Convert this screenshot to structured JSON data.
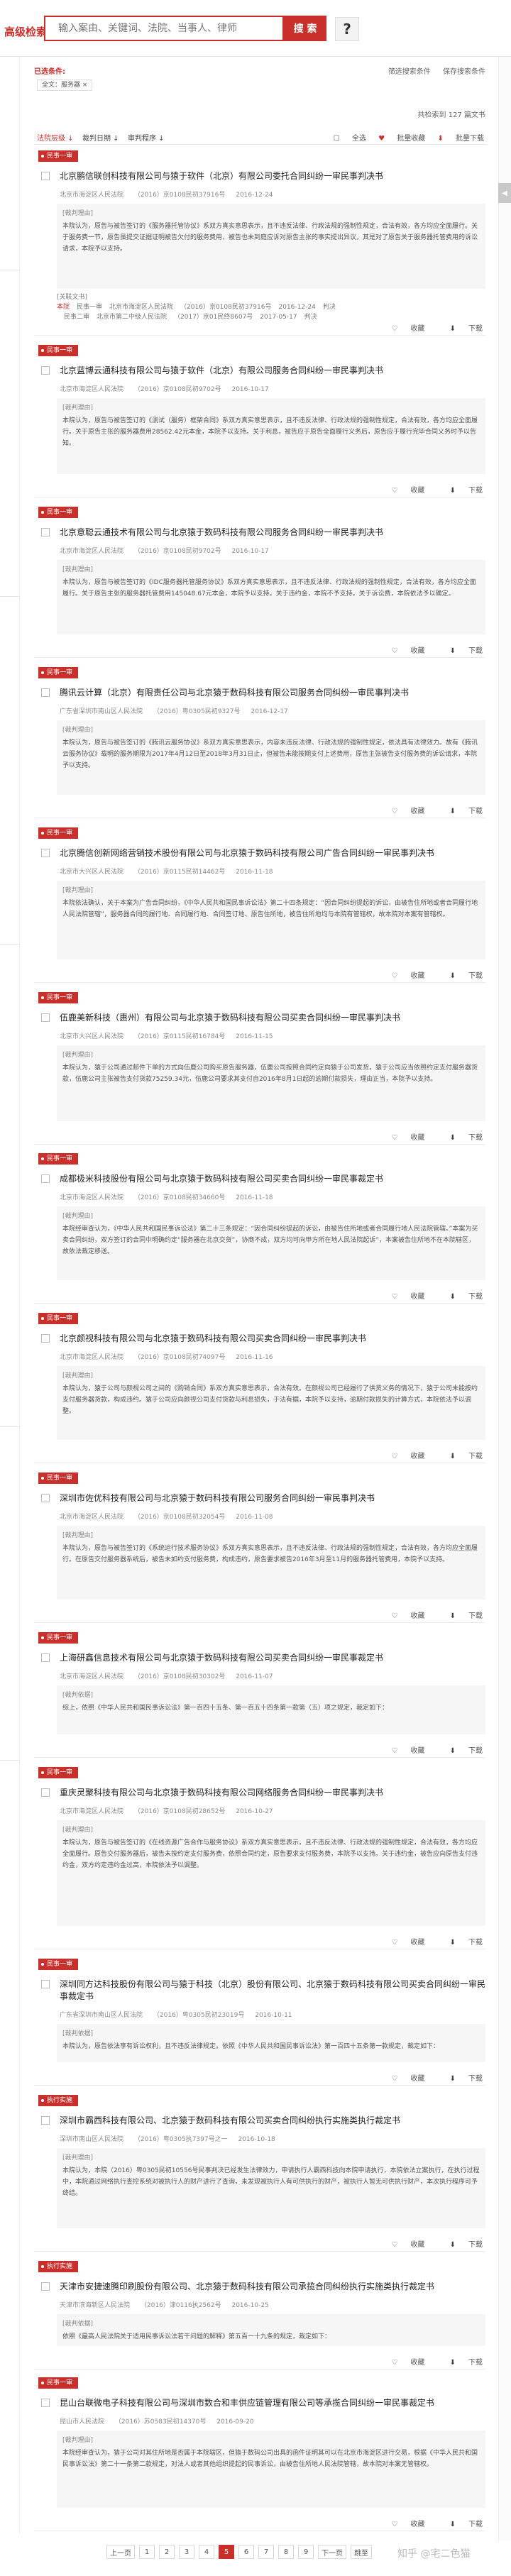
{
  "header": {
    "search_label": "高级检索",
    "search_placeholder": "输入案由、关键词、法院、当事人、律师",
    "search_button": "搜 索",
    "help_button": "?"
  },
  "filter": {
    "title": "已选条件:",
    "tag": "全文：服务器 ×",
    "links": [
      "筛选搜索条件",
      "保存搜索条件"
    ]
  },
  "result_count": "共检索到 127 篇文书",
  "sortbar": {
    "items": [
      "法院层级 ↓",
      "裁判日期 ↓",
      "审判程序 ↓"
    ],
    "tools": [
      "全选",
      "批量收藏",
      "批量下载"
    ]
  },
  "actions": {
    "favorite": "收藏",
    "download": "下载"
  },
  "cases": [
    {
      "tag": "民事一审",
      "title": "北京鹏信联创科技有限公司与猿于软件（北京）有限公司委托合同纠纷一审民事判决书",
      "court": "北京市海淀区人民法院",
      "case_no": "（2016）京0108民初37916号",
      "date": "2016-12-24",
      "label": "[裁判理由]",
      "excerpt": "本院认为，原告与被告签订的《服务器托管协议》系双方真实意思表示，且不违反法律、行政法规的强制性规定，合法有效，各方均应全面履行。关于服务费一节，原告虽提交证据证明被告欠付的服务费用，被告也未到庭应诉对原告主张的事实提出异议，其是对了原告关于服务器托管费用的诉讼请求，本院予以支持。",
      "trial_title": "[关联文书]",
      "trial_rows": [
        [
          "本院",
          "民事一审",
          "北京市海淀区人民法院",
          "（2016）京0108民初37916号",
          "2016-12-24",
          "判决"
        ],
        [
          "",
          "民事二审",
          "北京市第二中级人民法院",
          "（2017）京01民终8607号",
          "2017-05-17",
          "判决"
        ]
      ]
    },
    {
      "tag": "民事一审",
      "title": "北京蓝博云通科技有限公司与猿于软件（北京）有限公司服务合同纠纷一审民事判决书",
      "court": "北京市海淀区人民法院",
      "case_no": "（2016）京0108民初9702号",
      "date": "2016-10-17",
      "label": "[裁判理由]",
      "excerpt": "本院认为，原告与被告签订的《测试（服务）框架合同》系双方真实意思表示，且不违反法律、行政法规的强制性规定，合法有效，各方均应全面履行。关于原告主张的服务器费用28562.42元本金，本院予以支持。关于利息，被告应于原告全面履行义务后，原告应于履行完毕合同义务时予以告知。"
    },
    {
      "tag": "民事一审",
      "title": "北京意聪云通技术有限公司与北京猿于数码科技有限公司服务合同纠纷一审民事判决书",
      "court": "北京市海淀区人民法院",
      "case_no": "（2016）京0108民初9702号",
      "date": "2016-10-17",
      "label": "[裁判理由]",
      "excerpt": "本院认为，原告与被告签订的《IDC服务器托管服务协议》系双方真实意思表示，且不违反法律、行政法规的强制性规定，合法有效，各方均应全面履行。关于原告主张的服务器托管费用145048.67元本金，本院予以支持。关于违约金，本院不予支持。关于诉讼费，本院依法予以确定。"
    },
    {
      "tag": "民事一审",
      "title": "腾讯云计算（北京）有限责任公司与北京猿于数码科技有限公司服务合同纠纷一审民事判决书",
      "court": "广东省深圳市南山区人民法院",
      "case_no": "（2016）粤0305民初9327号",
      "date": "2016-12-17",
      "label": "[裁判理由]",
      "excerpt": "本院认为，原告与被告签订的《腾讯云服务协议》系双方真实意思表示，内容未违反法律、行政法规的强制性规定，依法具有法律效力。故有《腾讯云服务协议》载明的服务期限为2017年4月12日至2018年3月31日止，但被告未能按期支付上述费用，原告主张被告支付服务费的诉讼请求，本院予以支持。"
    },
    {
      "tag": "民事一审",
      "title": "北京腾信创新网络营销技术股份有限公司与北京猿于数码科技有限公司广告合同纠纷一审民事判决书",
      "court": "北京市大兴区人民法院",
      "case_no": "（2016）京0115民初14462号",
      "date": "2016-11-18",
      "label": "[裁判理由]",
      "excerpt": "本院依法确认，关于本案为广告合同纠纷，《中华人民共和国民事诉讼法》第二十四条规定：“因合同纠纷提起的诉讼，由被告住所地或者合同履行地人民法院管辖”，服务器合同的履行地、合同履行地、合同签订地、原告住所地，被告住所地均与本院有管辖权，故本院对本案有管辖权。"
    },
    {
      "tag": "民事一审",
      "title": "伍鹿美新科技（惠州）有限公司与北京猿于数码科技有限公司买卖合同纠纷一审民事判决书",
      "court": "北京市大兴区人民法院",
      "case_no": "（2016）京0115民初16784号",
      "date": "2016-11-15",
      "label": "[裁判理由]",
      "excerpt": "本院认为，猿于公司通过邮件下单的方式向伍鹿公司购买原告服务器，伍鹿公司按照合同约定向猿于公司发货，猿于公司应当依照约定支付服务器货款，伍鹿公司主张被告支付货款75259.34元，伍鹿公司要求其支付自2016年8月1日起的逾期付款损失，理由正当，本院予以支持。"
    },
    {
      "tag": "民事一审",
      "title": "成都极米科技股份有限公司与北京猿于数码科技有限公司买卖合同纠纷一审民事裁定书",
      "court": "北京市海淀区人民法院",
      "case_no": "（2016）京0108民初34660号",
      "date": "2016-11-18",
      "label": "[裁判理由]",
      "excerpt": "本院经审查认为，《中华人民共和国民事诉讼法》第二十三条规定：“因合同纠纷提起的诉讼，由被告住所地或者合同履行地人民法院管辖。”本案为买卖合同纠纷，双方签订的合同中明确约定“服务器在北京交货”，协商不成，双方均可向甲方所在地人民法院起诉”，本案被告住所地不在本院辖区，故依法裁定移送。"
    },
    {
      "tag": "民事一审",
      "title": "北京颜视科技有限公司与北京猿于数码科技有限公司买卖合同纠纷一审民事判决书",
      "court": "北京市海淀区人民法院",
      "case_no": "（2016）京0108民初74097号",
      "date": "2016-11-16",
      "label": "[裁判理由]",
      "excerpt": "本院认为，猿于公司与颜视公司之间的《购销合同》系双方真实意思表示，合法有效。在颜视公司已经履行了供货义务的情况下，猿于公司未能按约支付服务器货款，构成违约。猿于公司应向颜视公司支付货款与利息损失，于法有据，本院予以支持，逾期付款损失的计算方式，本院依法予以调整。"
    },
    {
      "tag": "民事一审",
      "title": "深圳市佐优科技有限公司与北京猿于数码科技有限公司服务合同纠纷一审民事判决书",
      "court": "北京市海淀区人民法院",
      "case_no": "（2016）京0108民初32054号",
      "date": "2016-11-08",
      "label": "[裁判理由]",
      "excerpt": "本院认为，原告与被告签订的《系统运行技术服务协议》系双方真实意思表示，且不违反法律、行政法规的强制性规定，合法有效，各方均应全面履行。在原告交付服务器系统后，被告未如约支付服务费，构成违约，原告要求被告2016年3月至11月的服务器托管费用，本院予以支持。"
    },
    {
      "tag": "民事一审",
      "title": "上海研鑫信息技术有限公司与北京猿于数码科技有限公司买卖合同纠纷一审民事裁定书",
      "court": "北京市海淀区人民法院",
      "case_no": "（2016）京0108民初30302号",
      "date": "2016-11-07",
      "label": "[裁判依据]",
      "excerpt": "综上，依照《中华人民共和国民事诉讼法》第一百四十五条、第一百五十四条第一款第（五）项之规定，裁定如下："
    },
    {
      "tag": "民事一审",
      "title": "重庆灵聚科技有限公司与北京猿于数码科技有限公司网络服务合同纠纷一审民事判决书",
      "court": "北京市海淀区人民法院",
      "case_no": "（2016）京0108民初28652号",
      "date": "2016-10-27",
      "label": "[裁判理由]",
      "excerpt": "本院认为，原告与被告签订的《在线资源广告合作与服务协议》系双方真实意思表示，且不违反法律、行政法规的强制性规定，合法有效，各方均应全面履行。原告交付服务器后，被告未按约定支付服务费，依照合同约定，原告要求支付服务费，本院予以支持。关于违约金，被告应向原告支付违约金，双方约定违约金过高，本院依法予以调整。"
    },
    {
      "tag": "民事一审",
      "title": "深圳同方达科技股份有限公司与猿于科技（北京）股份有限公司、北京猿于数码科技有限公司买卖合同纠纷一审民事裁定书",
      "court": "广东省深圳市南山区人民法院",
      "case_no": "（2016）粤0305民初23019号",
      "date": "2016-10-11",
      "label": "[裁判依据]",
      "excerpt": "本院认为，原告依法享有诉讼权利，且不违反法律规定。依照《中华人民共和国民事诉讼法》第一百四十五条第一款规定，裁定如下："
    },
    {
      "tag": "执行实施",
      "title": "深圳市霸西科技有限公司、北京猿于数码科技有限公司买卖合同纠纷执行实施类执行裁定书",
      "court": "深圳市南山区人民法院",
      "case_no": "（2016）粤0305执7397号之一",
      "date": "2016-10-18",
      "label": "[裁判理由]",
      "excerpt": "本院认为，本院（2016）粤0305民初10556号民事判决已经发生法律效力，申请执行人霸西科技向本院申请执行，本院依法立案执行，在执行过程中，本院通过网络执行查控系统对被执行人的财产进行了查询，未发现被执行人有可供执行的财产，被执行人暂无可供执行财产，本次执行程序可予终结。"
    },
    {
      "tag": "执行实施",
      "title": "天津市安捷速腾印刷股份有限公司、北京猿于数码科技有限公司承揽合同纠纷执行实施类执行裁定书",
      "court": "天津市滨海新区人民法院",
      "case_no": "（2016）津0116执2562号",
      "date": "2016-10-25",
      "label": "[裁判依据]",
      "excerpt": "依照《最高人民法院关于适用民事诉讼法若干问题的解释》第五百一十九条的规定，裁定如下："
    },
    {
      "tag": "民事一审",
      "title": "昆山台联微电子科技有限公司与深圳市数合和丰供应链管理有限公司等承揽合同纠纷一审民事裁定书",
      "court": "昆山市人民法院",
      "case_no": "（2016）苏0583民初14370号",
      "date": "2016-09-20",
      "label": "[裁判理由]",
      "excerpt": "本院经审查认为，猿于公司对其住所地是否属于本院辖区，但猿于数码公司出具的函件证明其可以在北京市海淀区进行交易，根据《中华人民共和国民事诉讼法》第二十一条第二款规定，对法人或者其他组织提起的民事诉讼，由被告住所地人民法院管辖，故本院对本案无管辖权。"
    }
  ],
  "pager": [
    "上一页",
    "1",
    "2",
    "3",
    "4",
    "5",
    "6",
    "7",
    "8",
    "9",
    "下一页",
    "跳至"
  ],
  "pager_current": "5",
  "watermark": "知乎 @宅二色猫"
}
